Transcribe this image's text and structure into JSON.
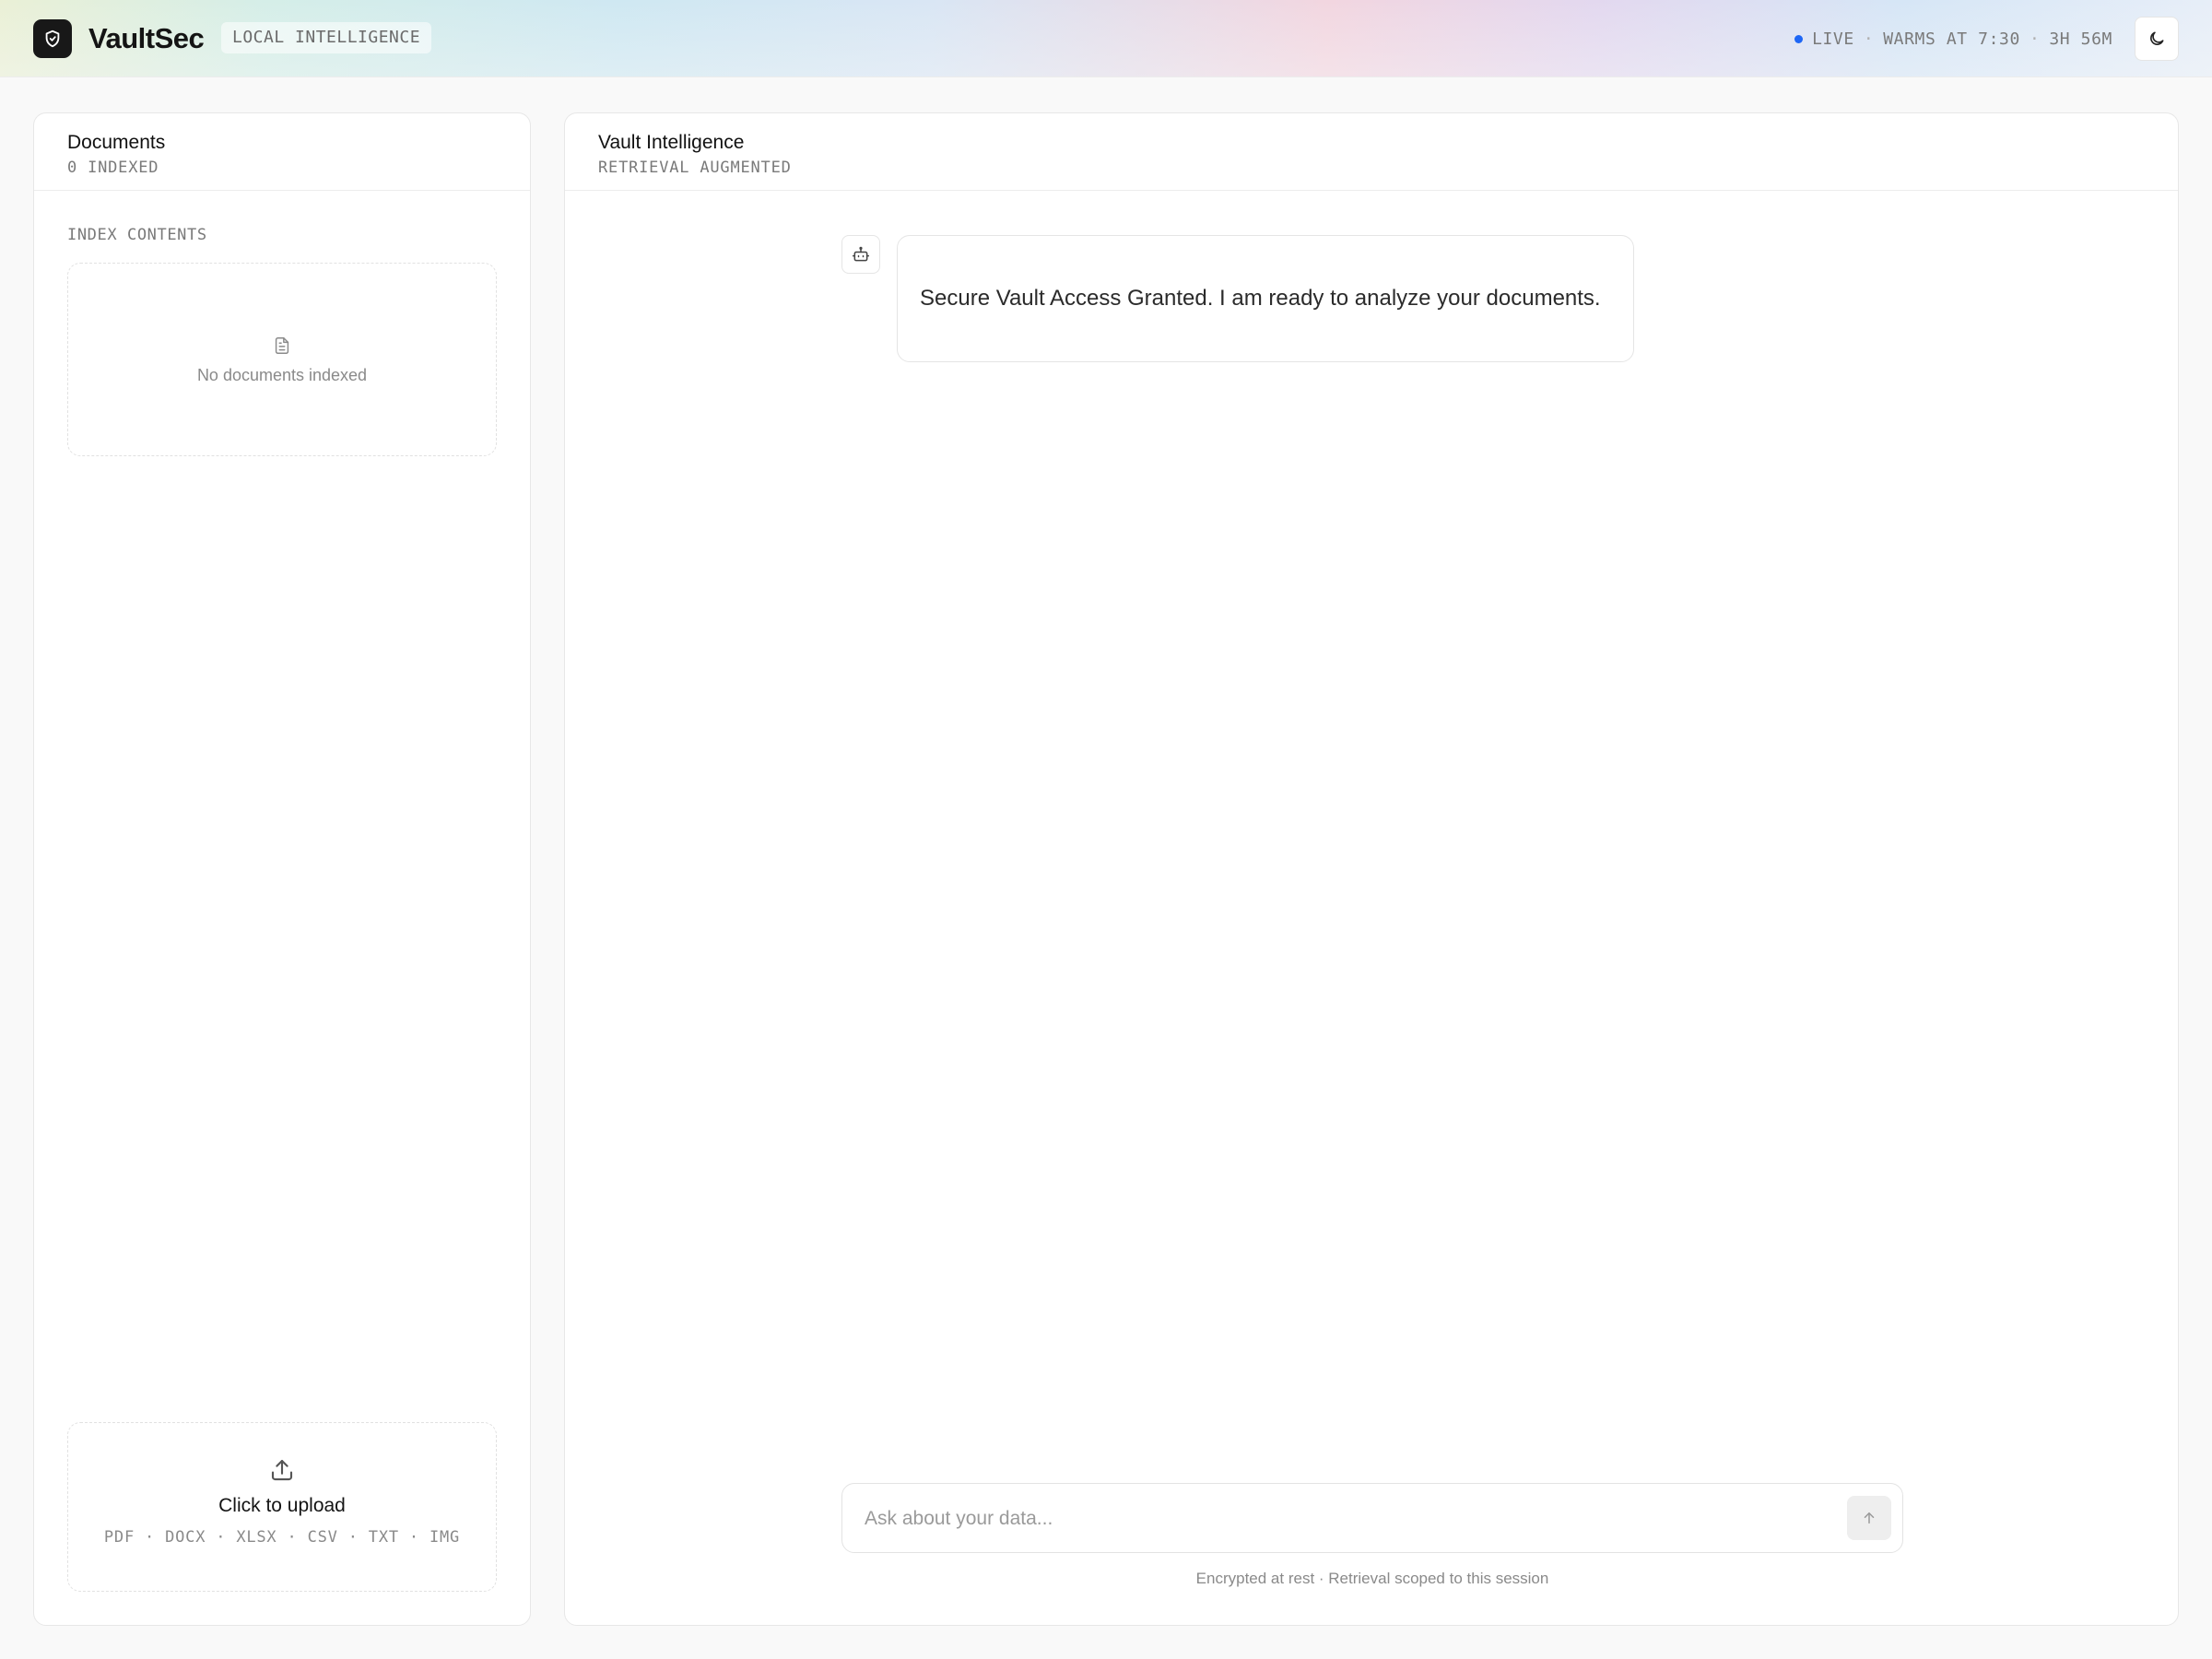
{
  "header": {
    "brand_name": "VaultSec",
    "brand_tag": "LOCAL INTELLIGENCE",
    "status": {
      "live_label": "LIVE",
      "separator": "·",
      "warms_label": "WARMS AT 7:30",
      "countdown": "3H 56M",
      "dot_color": "#1e66f5"
    },
    "theme_toggle_icon": "moon-icon",
    "logo_icon": "shield-icon"
  },
  "documents_panel": {
    "title": "Documents",
    "subtitle": "0 INDEXED",
    "section_label": "INDEX CONTENTS",
    "empty_state": {
      "icon": "file-text-icon",
      "text": "No documents indexed"
    },
    "upload": {
      "icon": "upload-icon",
      "title": "Click to upload",
      "types": "PDF · DOCX · XLSX · CSV · TXT · IMG"
    }
  },
  "chat_panel": {
    "title": "Vault Intelligence",
    "subtitle": "RETRIEVAL AUGMENTED",
    "messages": [
      {
        "role": "assistant",
        "avatar_icon": "bot-icon",
        "text": "Secure Vault Access Granted. I am ready to analyze your documents."
      }
    ],
    "composer": {
      "placeholder": "Ask about your data...",
      "value": "",
      "send_icon": "arrow-up-icon"
    },
    "footnote": "Encrypted at rest · Retrieval scoped to this session"
  }
}
